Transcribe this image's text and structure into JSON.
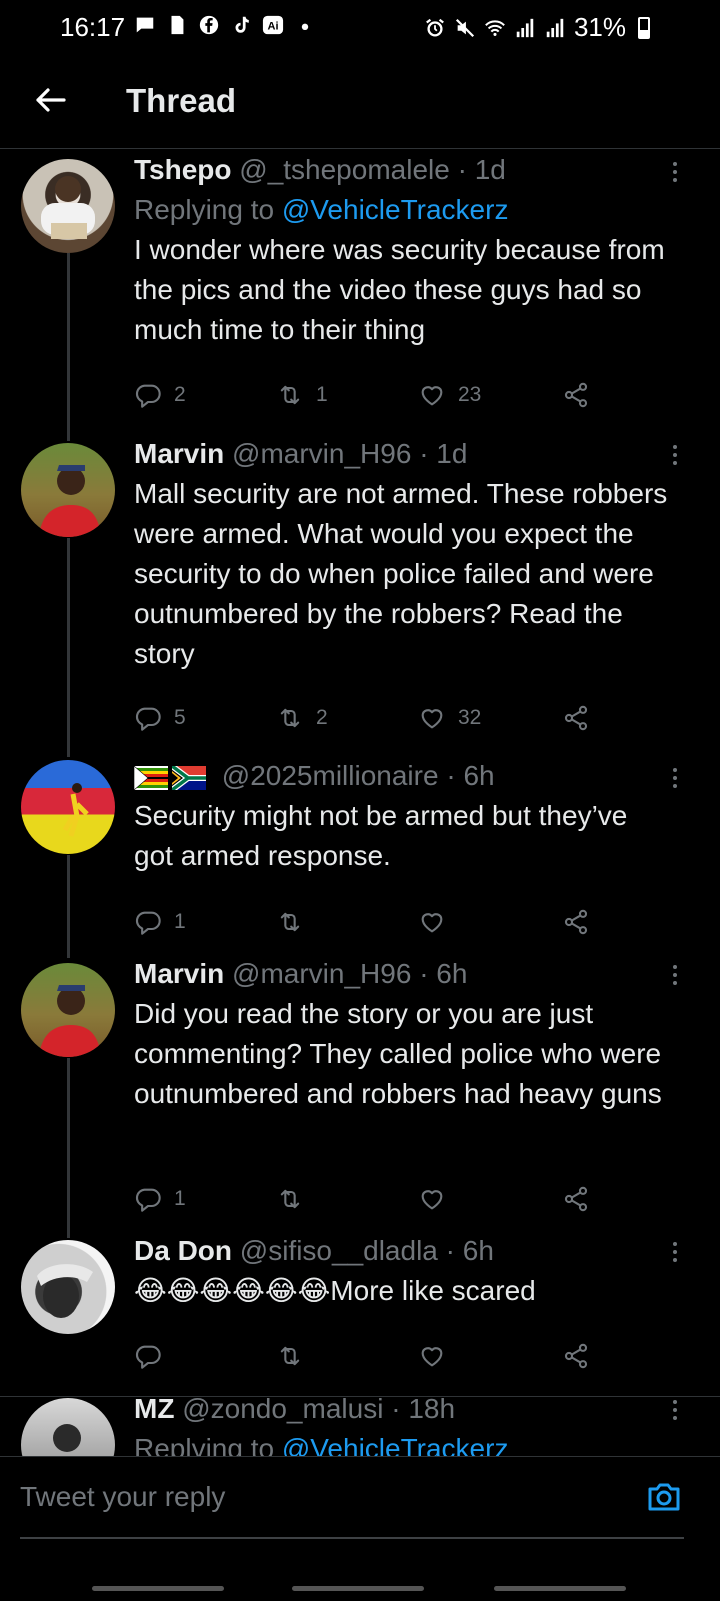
{
  "status_bar": {
    "time": "16:17",
    "battery": "31%",
    "left_icons": [
      "message-icon",
      "sim-icon",
      "facebook-icon",
      "tiktok-icon",
      "ai-icon",
      "dot-icon"
    ],
    "right_icons": [
      "alarm-icon",
      "mute-icon",
      "wifi-icon",
      "signal-icon",
      "signal-icon",
      "battery-icon"
    ]
  },
  "header": {
    "title": "Thread"
  },
  "tweets": [
    {
      "name": "Tshepo",
      "handle": "@_tshepomalele",
      "time": "1d",
      "replying_label": "Replying to",
      "replying_to": "@VehicleTrackerz",
      "text": "I wonder where was security because from the pics and the video these guys had so much time to their thing",
      "replies": "2",
      "retweets": "1",
      "likes": "23"
    },
    {
      "name": "Marvin",
      "handle": "@marvin_H96",
      "time": "1d",
      "text": "Mall security are not armed. These robbers were armed. What would you expect the security to do when police failed and were outnumbered by the robbers? Read the story",
      "replies": "5",
      "retweets": "2",
      "likes": "32"
    },
    {
      "name": "",
      "handle": "@2025millionaire",
      "time": "6h",
      "text": "Security might not be armed but they’ve got armed response.",
      "replies": "1",
      "retweets": "",
      "likes": ""
    },
    {
      "name": "Marvin",
      "handle": "@marvin_H96",
      "time": "6h",
      "text": "Did you read the story or you are just commenting? They called police who were outnumbered and robbers had heavy guns",
      "replies": "1",
      "retweets": "",
      "likes": ""
    },
    {
      "name": "Da Don",
      "handle": "@sifiso__dladla",
      "time": "6h",
      "text": "😂😂😂😂😂😂More like scared",
      "replies": "",
      "retweets": "",
      "likes": ""
    },
    {
      "name": "MZ",
      "handle": "@zondo_malusi",
      "time": "18h",
      "replying_label": "Replying to",
      "replying_to": "@VehicleTrackerz"
    }
  ],
  "reply_bar": {
    "placeholder": "Tweet your reply"
  },
  "separator": "·",
  "colors": {
    "accent": "#1d9bf0",
    "muted": "#71767b",
    "text": "#e7e9ea",
    "background": "#000000"
  }
}
